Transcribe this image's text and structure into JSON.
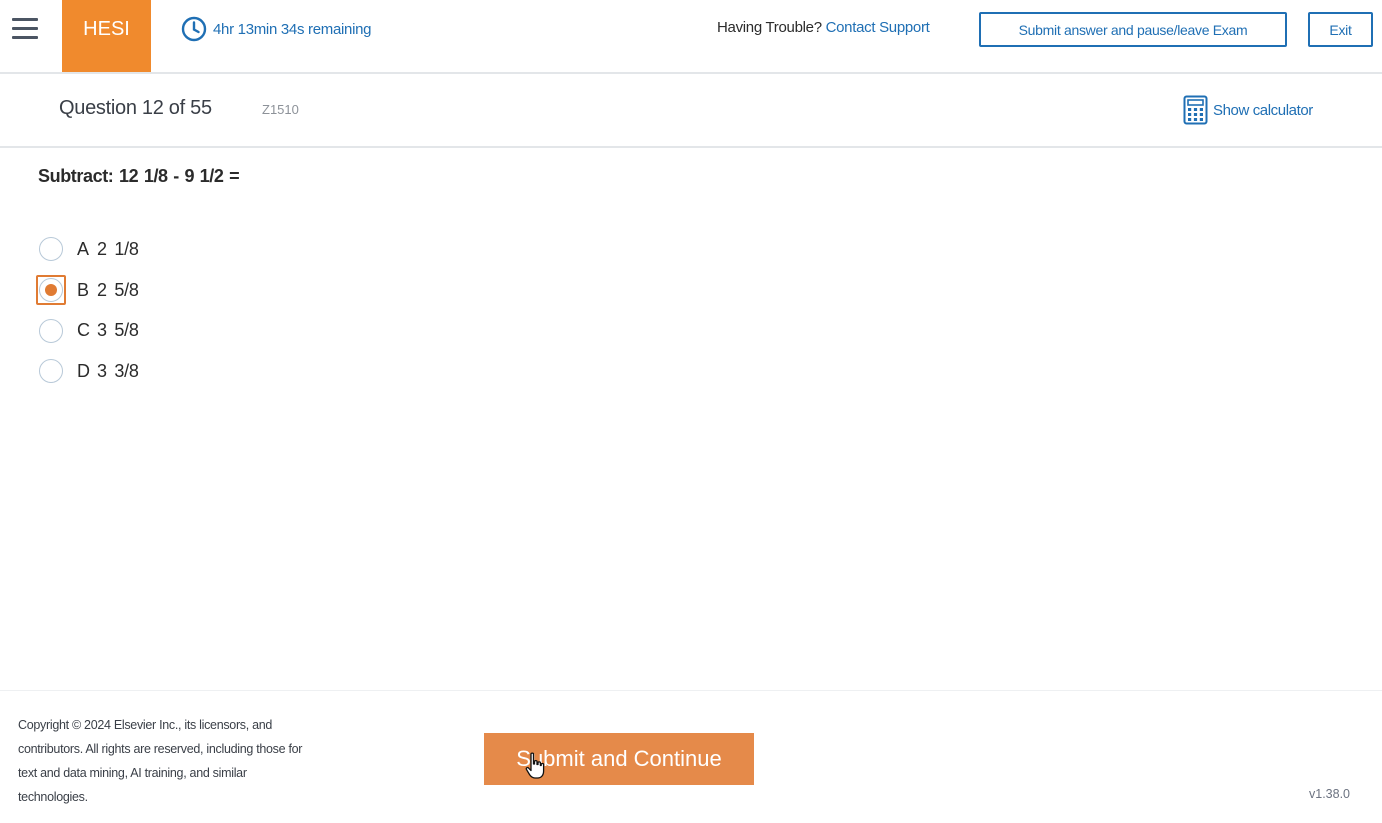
{
  "header": {
    "brand": "HESI",
    "timer": "4hr 13min 34s remaining",
    "trouble_text": "Having Trouble?",
    "support_link": "Contact Support",
    "pause_button": "Submit answer and pause/leave Exam",
    "exit_button": "Exit",
    "accent_color": "#f08a2d",
    "link_color": "#1f6fb4"
  },
  "question_header": {
    "question_number": "Question 12 of 55",
    "question_id": "Z1510",
    "calculator_label": "Show calculator"
  },
  "question": {
    "stem": "Subtract: 12  1/8 - 9  1/2 =",
    "options": [
      {
        "letter": "A",
        "text": "2  1/8",
        "selected": false
      },
      {
        "letter": "B",
        "text": "2  5/8",
        "selected": true
      },
      {
        "letter": "C",
        "text": "3  5/8",
        "selected": false
      },
      {
        "letter": "D",
        "text": "3  3/8",
        "selected": false
      }
    ]
  },
  "footer": {
    "copyright_lines": [
      "Copyright © 2024 Elsevier Inc., its licensors, and",
      "contributors. All rights are reserved, including those for",
      "text and data mining, AI training, and similar",
      "technologies."
    ],
    "submit_button": "Submit and Continue",
    "version": "v1.38.0"
  },
  "icons": {
    "menu": "hamburger-icon",
    "timer": "clock-icon",
    "calculator": "calculator-icon",
    "cursor": "hand-pointer-icon"
  }
}
